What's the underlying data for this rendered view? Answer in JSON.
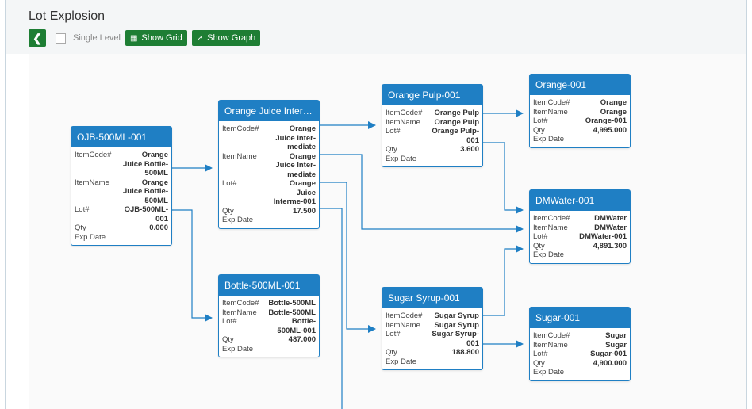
{
  "header": {
    "title": "Lot Explosion",
    "single_level_label": "Single Level",
    "show_grid_label": "Show Grid",
    "show_graph_label": "Show Graph"
  },
  "nodes": [
    {
      "title": "OJB-500ML-001",
      "item_code": "Orange\nJuice Bottle-\n500ML",
      "item_name": "Orange\nJuice Bottle-\n500ML",
      "lot": "OJB-500ML-\n001",
      "qty": "0.000",
      "exp_date": ""
    },
    {
      "title": "Orange Juice Interm...",
      "item_code": "Orange\nJuice Inter-\nmediate",
      "item_name": "Orange\nJuice Inter-\nmediate",
      "lot": "Orange\nJuice\nInterme-001",
      "qty": "17.500",
      "exp_date": ""
    },
    {
      "title": "Bottle-500ML-001",
      "item_code": "Bottle-500ML",
      "item_name": "Bottle-500ML",
      "lot": "Bottle-\n500ML-001",
      "qty": "487.000",
      "exp_date": ""
    },
    {
      "title": "Orange Pulp-001",
      "item_code": "Orange Pulp",
      "item_name": "Orange Pulp",
      "lot": "Orange Pulp-\n001",
      "qty": "3.600",
      "exp_date": ""
    },
    {
      "title": "Sugar Syrup-001",
      "item_code": "Sugar Syrup",
      "item_name": "Sugar Syrup",
      "lot": "Sugar Syrup-\n001",
      "qty": "188.800",
      "exp_date": ""
    },
    {
      "title": "Orange-001",
      "item_code": "Orange",
      "item_name": "Orange",
      "lot": "Orange-001",
      "qty": "4,995.000",
      "exp_date": ""
    },
    {
      "title": "DMWater-001",
      "item_code": "DMWater",
      "item_name": "DMWater",
      "lot": "DMWater-001",
      "qty": "4,891.300",
      "exp_date": ""
    },
    {
      "title": "Sugar-001",
      "item_code": "Sugar",
      "item_name": "Sugar",
      "lot": "Sugar-001",
      "qty": "4,900.000",
      "exp_date": ""
    }
  ],
  "field_labels": {
    "item_code": "ItemCode#",
    "item_name": "ItemName",
    "lot": "Lot#",
    "qty": "Qty",
    "exp_date": "Exp Date"
  },
  "colors": {
    "node_header": "#1f7fc4",
    "edge": "#1f7fc4",
    "button": "#1e7e34"
  },
  "icons": {
    "back": "chevron-left-icon",
    "grid": "grid-icon",
    "graph": "graph-icon"
  }
}
